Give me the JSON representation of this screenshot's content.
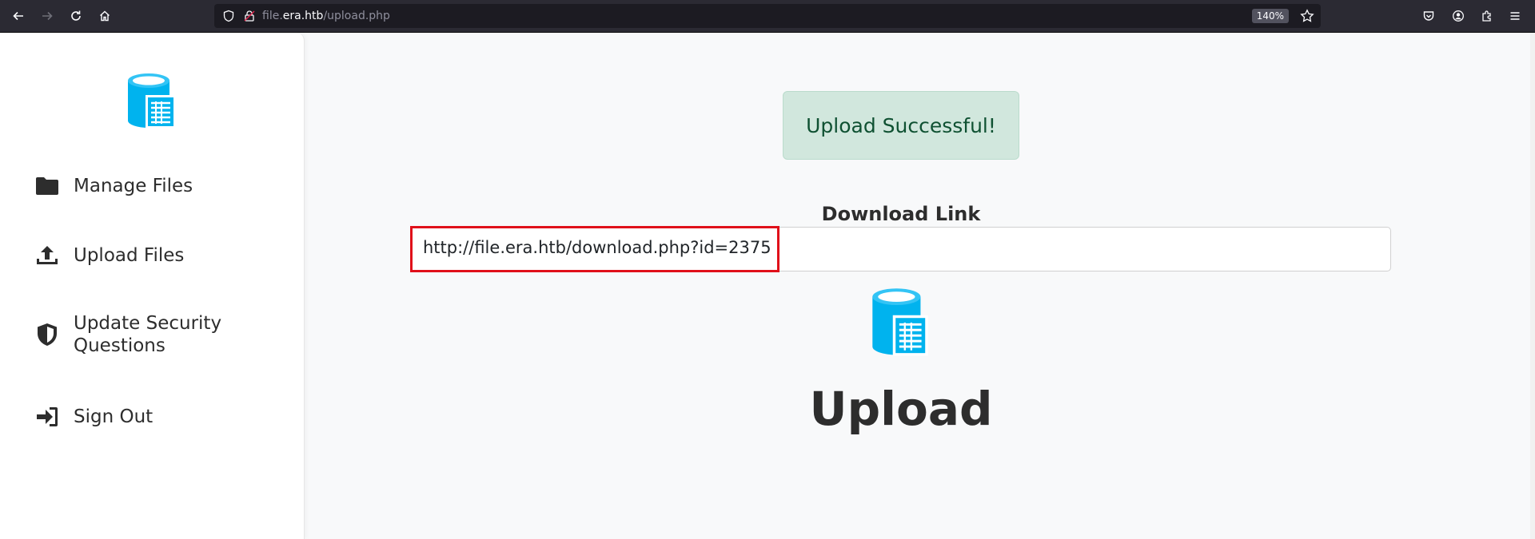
{
  "browser": {
    "url_subdomain": "file.",
    "url_domain": "era.htb",
    "url_path": "/upload.php",
    "zoom": "140%"
  },
  "sidebar": {
    "items": [
      {
        "label": "Manage Files",
        "icon": "folder-icon"
      },
      {
        "label": "Upload Files",
        "icon": "upload-icon"
      },
      {
        "label": "Update Security Questions",
        "icon": "shield-icon"
      },
      {
        "label": "Sign Out",
        "icon": "sign-out-icon"
      }
    ]
  },
  "main": {
    "alert": "Upload Successful!",
    "download_label": "Download Link",
    "download_url": "http://file.era.htb/download.php?id=2375",
    "title": "Upload"
  },
  "colors": {
    "accent": "#00b3ee",
    "alert_bg": "#d1e7dd",
    "alert_text": "#0f5132",
    "highlight": "#e0101a"
  }
}
